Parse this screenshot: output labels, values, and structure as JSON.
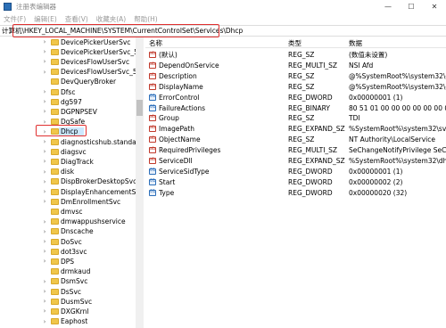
{
  "window": {
    "title": "注册表编辑器",
    "minimize": "—",
    "maximize": "☐",
    "close": "✕"
  },
  "menu": [
    "文件(F)",
    "编辑(E)",
    "查看(V)",
    "收藏夹(A)",
    "帮助(H)"
  ],
  "address": {
    "label": "计算机",
    "path": "\\HKEY_LOCAL_MACHINE\\SYSTEM\\CurrentControlSet\\Services\\Dhcp"
  },
  "tree": {
    "items": [
      {
        "label": "DevicePickerUserSvc",
        "expandable": true
      },
      {
        "label": "DevicePickerUserSvc_5578",
        "expandable": true
      },
      {
        "label": "DevicesFlowUserSvc",
        "expandable": true
      },
      {
        "label": "DevicesFlowUserSvc_5578",
        "expandable": true
      },
      {
        "label": "DevQueryBroker",
        "expandable": false
      },
      {
        "label": "Dfsc",
        "expandable": true
      },
      {
        "label": "dg597",
        "expandable": true
      },
      {
        "label": "DGPNPSEV",
        "expandable": true
      },
      {
        "label": "DgSafe",
        "expandable": true
      },
      {
        "label": "Dhcp",
        "expandable": true,
        "selected": true
      },
      {
        "label": "diagnosticshub.standardco",
        "expandable": true
      },
      {
        "label": "diagsvc",
        "expandable": true
      },
      {
        "label": "DiagTrack",
        "expandable": true
      },
      {
        "label": "disk",
        "expandable": true
      },
      {
        "label": "DispBrokerDesktopSvc",
        "expandable": true
      },
      {
        "label": "DisplayEnhancementSvc",
        "expandable": true
      },
      {
        "label": "DmEnrollmentSvc",
        "expandable": true
      },
      {
        "label": "dmvsc",
        "expandable": false
      },
      {
        "label": "dmwappushservice",
        "expandable": true
      },
      {
        "label": "Dnscache",
        "expandable": true
      },
      {
        "label": "DoSvc",
        "expandable": true
      },
      {
        "label": "dot3svc",
        "expandable": true
      },
      {
        "label": "DPS",
        "expandable": true
      },
      {
        "label": "drmkaud",
        "expandable": false
      },
      {
        "label": "DsmSvc",
        "expandable": true
      },
      {
        "label": "DsSvc",
        "expandable": true
      },
      {
        "label": "DusmSvc",
        "expandable": true
      },
      {
        "label": "DXGKrnl",
        "expandable": true
      },
      {
        "label": "Eaphost",
        "expandable": true
      }
    ],
    "arrow_collapsed": "›",
    "arrow_expanded": "⌄"
  },
  "list": {
    "headers": [
      "名称",
      "类型",
      "数据"
    ],
    "rows": [
      {
        "icon": "ab",
        "name": "(默认)",
        "type": "REG_SZ",
        "data": "(数值未设置)"
      },
      {
        "icon": "ab",
        "name": "DependOnService",
        "type": "REG_MULTI_SZ",
        "data": "NSI Afd"
      },
      {
        "icon": "ab",
        "name": "Description",
        "type": "REG_SZ",
        "data": "@%SystemRoot%\\system32\\dhcpco"
      },
      {
        "icon": "ab",
        "name": "DisplayName",
        "type": "REG_SZ",
        "data": "@%SystemRoot%\\system32\\dhcpco"
      },
      {
        "icon": "bin",
        "name": "ErrorControl",
        "type": "REG_DWORD",
        "data": "0x00000001 (1)"
      },
      {
        "icon": "bin",
        "name": "FailureActions",
        "type": "REG_BINARY",
        "data": "80 51 01 00 00 00 00 00 00 00 00 00"
      },
      {
        "icon": "ab",
        "name": "Group",
        "type": "REG_SZ",
        "data": "TDI"
      },
      {
        "icon": "ab",
        "name": "ImagePath",
        "type": "REG_EXPAND_SZ",
        "data": "%SystemRoot%\\system32\\svchost."
      },
      {
        "icon": "ab",
        "name": "ObjectName",
        "type": "REG_SZ",
        "data": "NT Authority\\LocalService"
      },
      {
        "icon": "ab",
        "name": "RequiredPrivileges",
        "type": "REG_MULTI_SZ",
        "data": "SeChangeNotifyPrivilege SeCreateGl"
      },
      {
        "icon": "ab",
        "name": "ServiceDll",
        "type": "REG_EXPAND_SZ",
        "data": "%SystemRoot%\\system32\\dhcpcore."
      },
      {
        "icon": "bin",
        "name": "ServiceSidType",
        "type": "REG_DWORD",
        "data": "0x00000001 (1)"
      },
      {
        "icon": "bin",
        "name": "Start",
        "type": "REG_DWORD",
        "data": "0x00000002 (2)"
      },
      {
        "icon": "bin",
        "name": "Type",
        "type": "REG_DWORD",
        "data": "0x00000020 (32)"
      }
    ]
  },
  "colors": {
    "highlight": "#e03030",
    "folder": "#f0c64a",
    "selected_bg": "#cce8ff"
  }
}
